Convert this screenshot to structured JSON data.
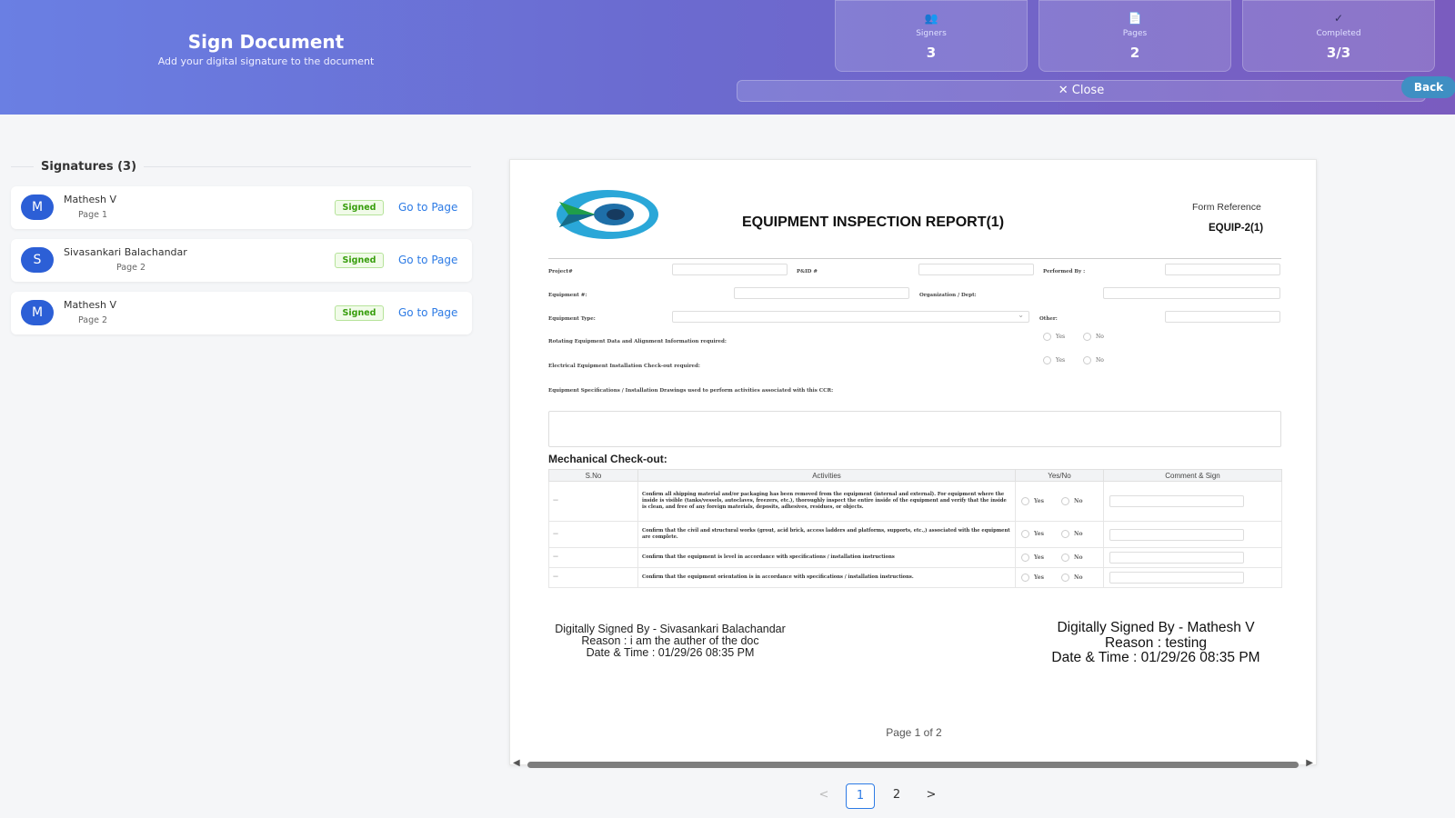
{
  "header": {
    "title": "Sign Document",
    "subtitle": "Add your digital signature to the document",
    "stats": [
      {
        "icon": "users-icon",
        "glyph": "👥",
        "label": "Signers",
        "value": "3"
      },
      {
        "icon": "page-icon",
        "glyph": "📄",
        "label": "Pages",
        "value": "2"
      },
      {
        "icon": "check-icon",
        "glyph": "✓",
        "label": "Completed",
        "value": "3/3"
      }
    ],
    "close_label": "✕ Close",
    "back_label": "Back"
  },
  "sidebar": {
    "heading": "Signatures (3)",
    "signatures": [
      {
        "initial": "M",
        "name": "Mathesh V",
        "page": "Page 1",
        "status": "Signed",
        "action": "Go to Page"
      },
      {
        "initial": "S",
        "name": "Sivasankari Balachandar",
        "page": "Page 2",
        "status": "Signed",
        "action": "Go to Page"
      },
      {
        "initial": "M",
        "name": "Mathesh V",
        "page": "Page 2",
        "status": "Signed",
        "action": "Go to Page"
      }
    ]
  },
  "document": {
    "title": "EQUIPMENT INSPECTION REPORT(1)",
    "form_reference_label": "Form Reference",
    "form_reference_value": "EQUIP-2(1)",
    "fields": {
      "project": "Project#",
      "pid": "P&ID #",
      "performed_by": "Performed By :",
      "equipment": "Equipment #:",
      "organization": "Organization / Dept:",
      "equipment_type": "Equipment Type:",
      "other": "Other:",
      "rotating": "Rotating Equipment Data and Alignment Information required:",
      "electrical": "Electrical Equipment Installation Check-out required:",
      "specs": "Equipment Specifications / Installation Drawings used to perform activities associated with this CCR:"
    },
    "yes_label": "Yes",
    "no_label": "No",
    "mechanical_heading": "Mechanical Check-out:",
    "table_headers": [
      "S.No",
      "Activities",
      "Yes/No",
      "Comment & Sign"
    ],
    "table_rows": [
      {
        "sno": "—",
        "activity": "Confirm all shipping material and/or packaging has been removed from the equipment (internal and external). For equipment where the inside is visible (tanks/vessels, autoclaves, freezers, etc.), thoroughly inspect the entire inside of the equipment and verify that the inside is clean, and free of any foreign materials, deposits, adhesives, residues, or objects."
      },
      {
        "sno": "—",
        "activity": "Confirm that the civil and structural works (grout, acid brick, access ladders and platforms, supports, etc.,) associated with the equipment are complete."
      },
      {
        "sno": "—",
        "activity": "Confirm that the equipment is level in accordance with specifications / installation instructions"
      },
      {
        "sno": "—",
        "activity": "Confirm that the equipment orientation is in accordance with specifications / installation instructions."
      }
    ],
    "signature_left": {
      "line1": "Digitally Signed By - Sivasankari Balachandar",
      "line2": "Reason : i am the auther of the doc",
      "line3": "Date & Time : 01/29/26 08:35 PM"
    },
    "signature_right": {
      "line1": "Digitally Signed By - Mathesh V",
      "line2": "Reason : testing",
      "line3": "Date & Time : 01/29/26 08:35 PM"
    },
    "page_indicator": "Page 1 of 2"
  },
  "pagination": {
    "prev": "<",
    "pages": [
      "1",
      "2"
    ],
    "next": ">",
    "current": "1"
  },
  "colors": {
    "accent": "#2d7be5",
    "avatar": "#2c5fd6",
    "signed_badge": "#389e0d",
    "header_start": "#6a7fe3",
    "header_end": "#7a5cbf"
  }
}
